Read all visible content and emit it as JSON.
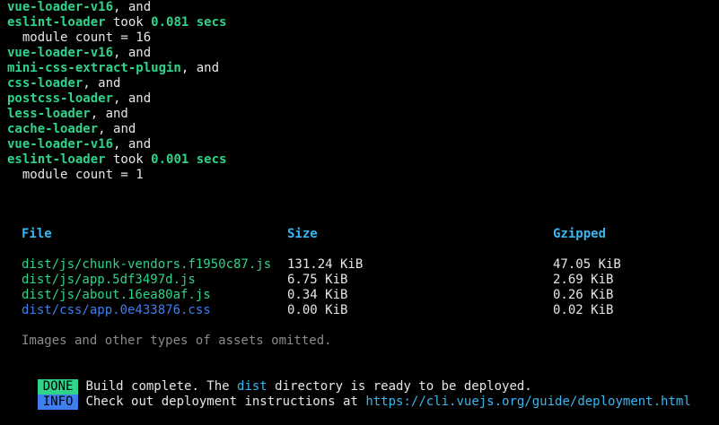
{
  "log_lines": [
    {
      "parts": [
        {
          "t": "vue-loader-v16",
          "c": "g"
        },
        {
          "t": ", and",
          "c": "w"
        }
      ]
    },
    {
      "parts": [
        {
          "t": "eslint-loader",
          "c": "g"
        },
        {
          "t": " took ",
          "c": "w"
        },
        {
          "t": "0.081 secs",
          "c": "g"
        }
      ]
    },
    {
      "parts": [
        {
          "t": "  module count = 16",
          "c": "w"
        }
      ]
    },
    {
      "parts": [
        {
          "t": "vue-loader-v16",
          "c": "g"
        },
        {
          "t": ", and",
          "c": "w"
        }
      ]
    },
    {
      "parts": [
        {
          "t": "mini-css-extract-plugin",
          "c": "g"
        },
        {
          "t": ", and",
          "c": "w"
        }
      ]
    },
    {
      "parts": [
        {
          "t": "css-loader",
          "c": "g"
        },
        {
          "t": ", and",
          "c": "w"
        }
      ]
    },
    {
      "parts": [
        {
          "t": "postcss-loader",
          "c": "g"
        },
        {
          "t": ", and",
          "c": "w"
        }
      ]
    },
    {
      "parts": [
        {
          "t": "less-loader",
          "c": "g"
        },
        {
          "t": ", and",
          "c": "w"
        }
      ]
    },
    {
      "parts": [
        {
          "t": "cache-loader",
          "c": "g"
        },
        {
          "t": ", and",
          "c": "w"
        }
      ]
    },
    {
      "parts": [
        {
          "t": "vue-loader-v16",
          "c": "g"
        },
        {
          "t": ", and",
          "c": "w"
        }
      ]
    },
    {
      "parts": [
        {
          "t": "eslint-loader",
          "c": "g"
        },
        {
          "t": " took ",
          "c": "w"
        },
        {
          "t": "0.001 secs",
          "c": "g"
        }
      ]
    },
    {
      "parts": [
        {
          "t": "  module count = 1",
          "c": "w"
        }
      ]
    }
  ],
  "assets_table": {
    "headers": {
      "file": "File",
      "size": "Size",
      "gzipped": "Gzipped"
    },
    "rows": [
      {
        "file": "dist/js/chunk-vendors.f1950c87.js",
        "size": "131.24 KiB",
        "gzipped": "47.05 KiB",
        "kind": "js"
      },
      {
        "file": "dist/js/app.5df3497d.js",
        "size": "6.75 KiB",
        "gzipped": "2.69 KiB",
        "kind": "js"
      },
      {
        "file": "dist/js/about.16ea80af.js",
        "size": "0.34 KiB",
        "gzipped": "0.26 KiB",
        "kind": "js"
      },
      {
        "file": "dist/css/app.0e433876.css",
        "size": "0.00 KiB",
        "gzipped": "0.02 KiB",
        "kind": "css"
      }
    ],
    "footnote": "Images and other types of assets omitted."
  },
  "done_line": {
    "badge": "DONE",
    "text_before": "Build complete. The ",
    "highlight": "dist",
    "text_after": " directory is ready to be deployed."
  },
  "info_line": {
    "badge": "INFO",
    "text": "Check out deployment instructions at ",
    "link": "https://cli.vuejs.org/guide/deployment.html"
  },
  "colors": {
    "background": "#000000",
    "green": "#2fd48a",
    "cyan": "#38b6f1",
    "blue": "#3e7ff0",
    "dim": "#8a8a8a",
    "text": "#e6e6e6"
  }
}
